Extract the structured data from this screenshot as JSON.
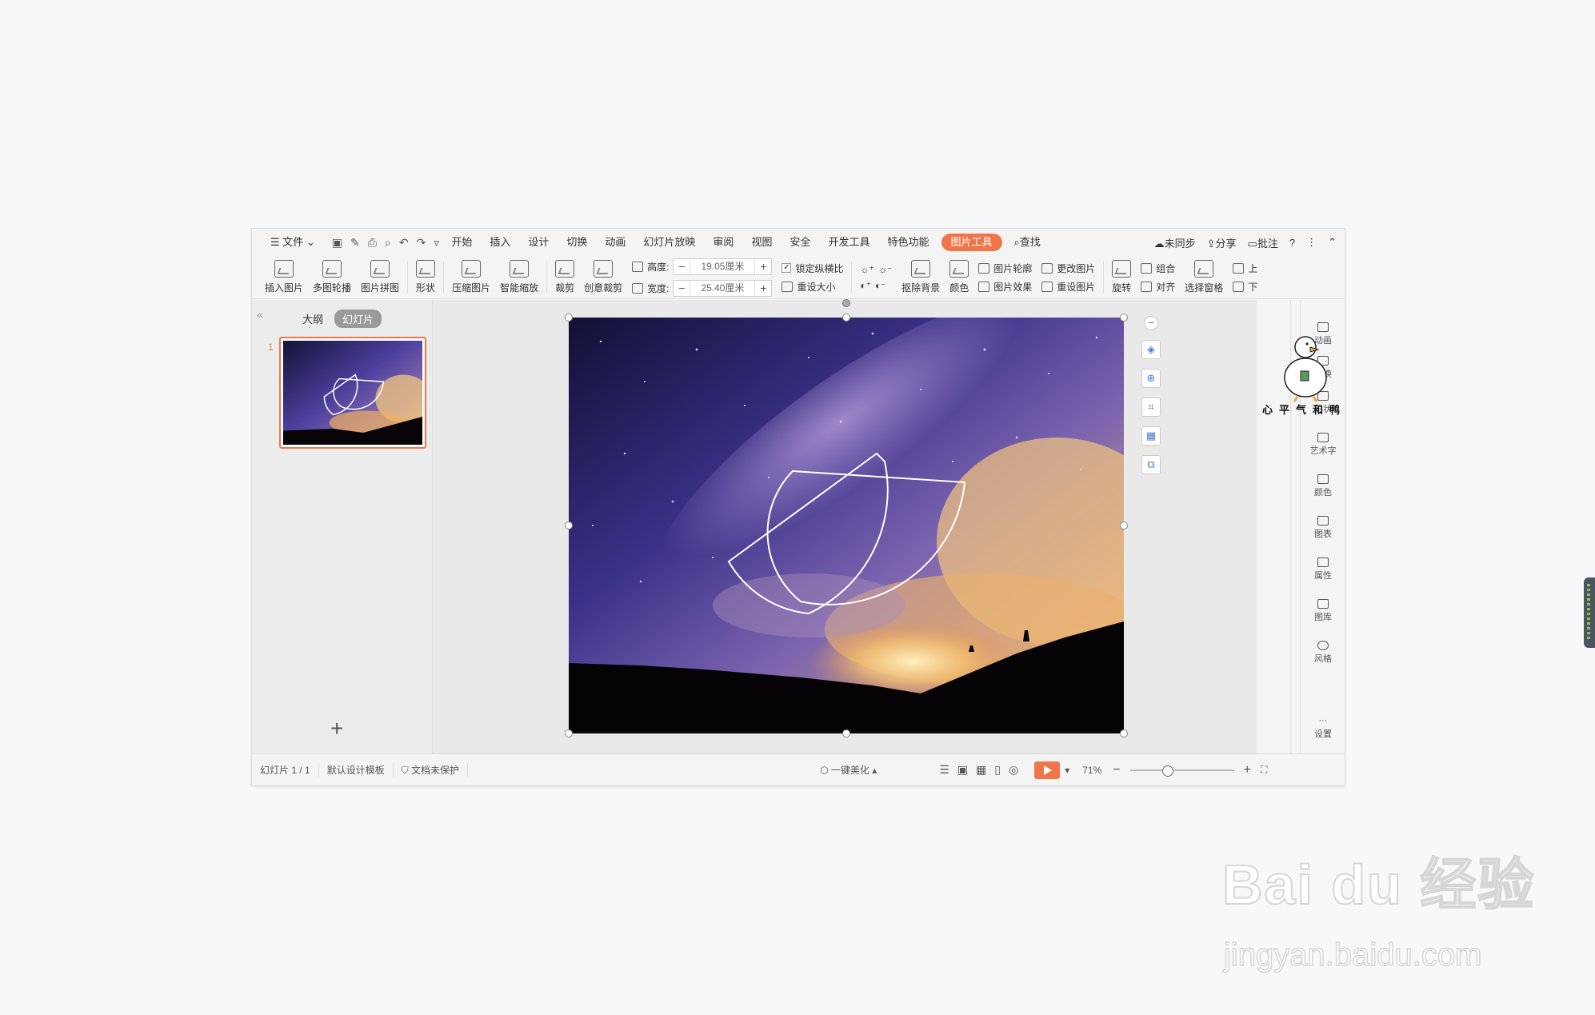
{
  "menubar": {
    "file": "文件",
    "tabs": [
      "开始",
      "插入",
      "设计",
      "切换",
      "动画",
      "幻灯片放映",
      "审阅",
      "视图",
      "安全",
      "开发工具",
      "特色功能"
    ],
    "active_tab": "图片工具",
    "search": "查找",
    "sync": "未同步",
    "share": "分享",
    "comment": "批注",
    "help": "?"
  },
  "ribbon": {
    "insert_pic": "插入图片",
    "multi_carousel": "多图轮播",
    "pic_collage": "图片拼图",
    "shape": "形状",
    "compress": "压缩图片",
    "smart_zoom": "智能缩放",
    "crop": "裁剪",
    "creative_crop": "创意裁剪",
    "height_label": "高度:",
    "height_value": "19.05厘米",
    "width_label": "宽度:",
    "width_value": "25.40厘米",
    "lock_ratio": "锁定纵横比",
    "reset_size": "重设大小",
    "remove_bg": "抠除背景",
    "color": "颜色",
    "pic_outline": "图片轮廓",
    "pic_effect": "图片效果",
    "change_pic": "更改图片",
    "reset_pic": "重设图片",
    "rotate": "旋转",
    "group": "组合",
    "align": "对齐",
    "select_pane": "选择窗格",
    "up": "上",
    "down": "下"
  },
  "leftpanel": {
    "outline_tab": "大纲",
    "slides_tab": "幻灯片",
    "slide_number": "1",
    "add": "+"
  },
  "sidebar": {
    "items": [
      "动画",
      "切换",
      "形状",
      "艺术字",
      "颜色",
      "图表",
      "属性",
      "图库",
      "风格",
      "设置"
    ],
    "sticker_text": "心平气和鸭"
  },
  "status": {
    "slide_count": "幻灯片 1 / 1",
    "template": "默认设计模板",
    "protect": "文档未保护",
    "beautify": "一键美化",
    "zoom": "71%"
  },
  "watermark": {
    "brand": "Bai du 经验",
    "url": "jingyan.baidu.com"
  },
  "colors": {
    "accent": "#f0764a",
    "sky_top": "#1b1a4a",
    "sky_mid": "#5a4aa8",
    "cloud": "#f5c37a"
  }
}
